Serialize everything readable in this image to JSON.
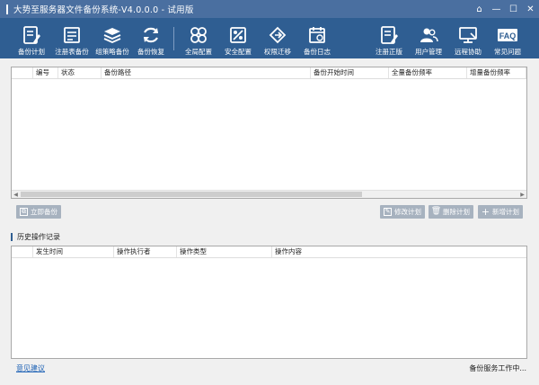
{
  "window": {
    "title": "大势至服务器文件备份系统-V4.0.0.0 - 试用版"
  },
  "toolbar": {
    "items": [
      {
        "label": "备份计划",
        "icon": "backup-plan-icon"
      },
      {
        "label": "注册表备份",
        "icon": "registry-icon"
      },
      {
        "label": "组策略备份",
        "icon": "layers-icon"
      },
      {
        "label": "备份恢复",
        "icon": "restore-icon"
      },
      {
        "label": "全局配置",
        "icon": "grid-icon"
      },
      {
        "label": "安全配置",
        "icon": "security-icon"
      },
      {
        "label": "权限迁移",
        "icon": "migrate-icon"
      },
      {
        "label": "备份日志",
        "icon": "calendar-icon"
      },
      {
        "label": "注册正版",
        "icon": "register-icon"
      },
      {
        "label": "用户管理",
        "icon": "users-icon"
      },
      {
        "label": "远程协助",
        "icon": "remote-icon"
      },
      {
        "label": "常见问题",
        "icon": "faq-icon",
        "glyph": "FAQ"
      }
    ]
  },
  "plan_table": {
    "columns": [
      "编号",
      "状态",
      "备份路径",
      "备份开始时间",
      "全量备份频率",
      "增量备份频率"
    ]
  },
  "actions": {
    "backup_now": "立即备份",
    "edit_plan": "修改计划",
    "delete_plan": "删除计划",
    "add_plan": "新增计划"
  },
  "history": {
    "title": "历史操作记录",
    "columns": [
      "发生时间",
      "操作执行者",
      "操作类型",
      "操作内容"
    ]
  },
  "footer": {
    "feedback": "意见建议",
    "status": "备份服务工作中..."
  }
}
